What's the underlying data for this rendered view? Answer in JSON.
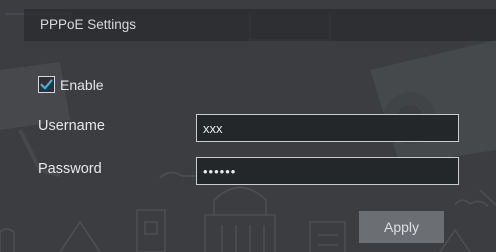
{
  "panel": {
    "title": "PPPoE Settings"
  },
  "form": {
    "enable": {
      "label": "Enable",
      "checked": true
    },
    "username": {
      "label": "Username",
      "value": "xxx"
    },
    "password": {
      "label": "Password",
      "value": "••••••"
    },
    "apply_label": "Apply"
  },
  "colors": {
    "background": "#3b3d40",
    "title_bar": "#242527",
    "checkmark": "#2ab7ea",
    "input_bg": "#24272a",
    "button_bg": "#6b6e72"
  }
}
